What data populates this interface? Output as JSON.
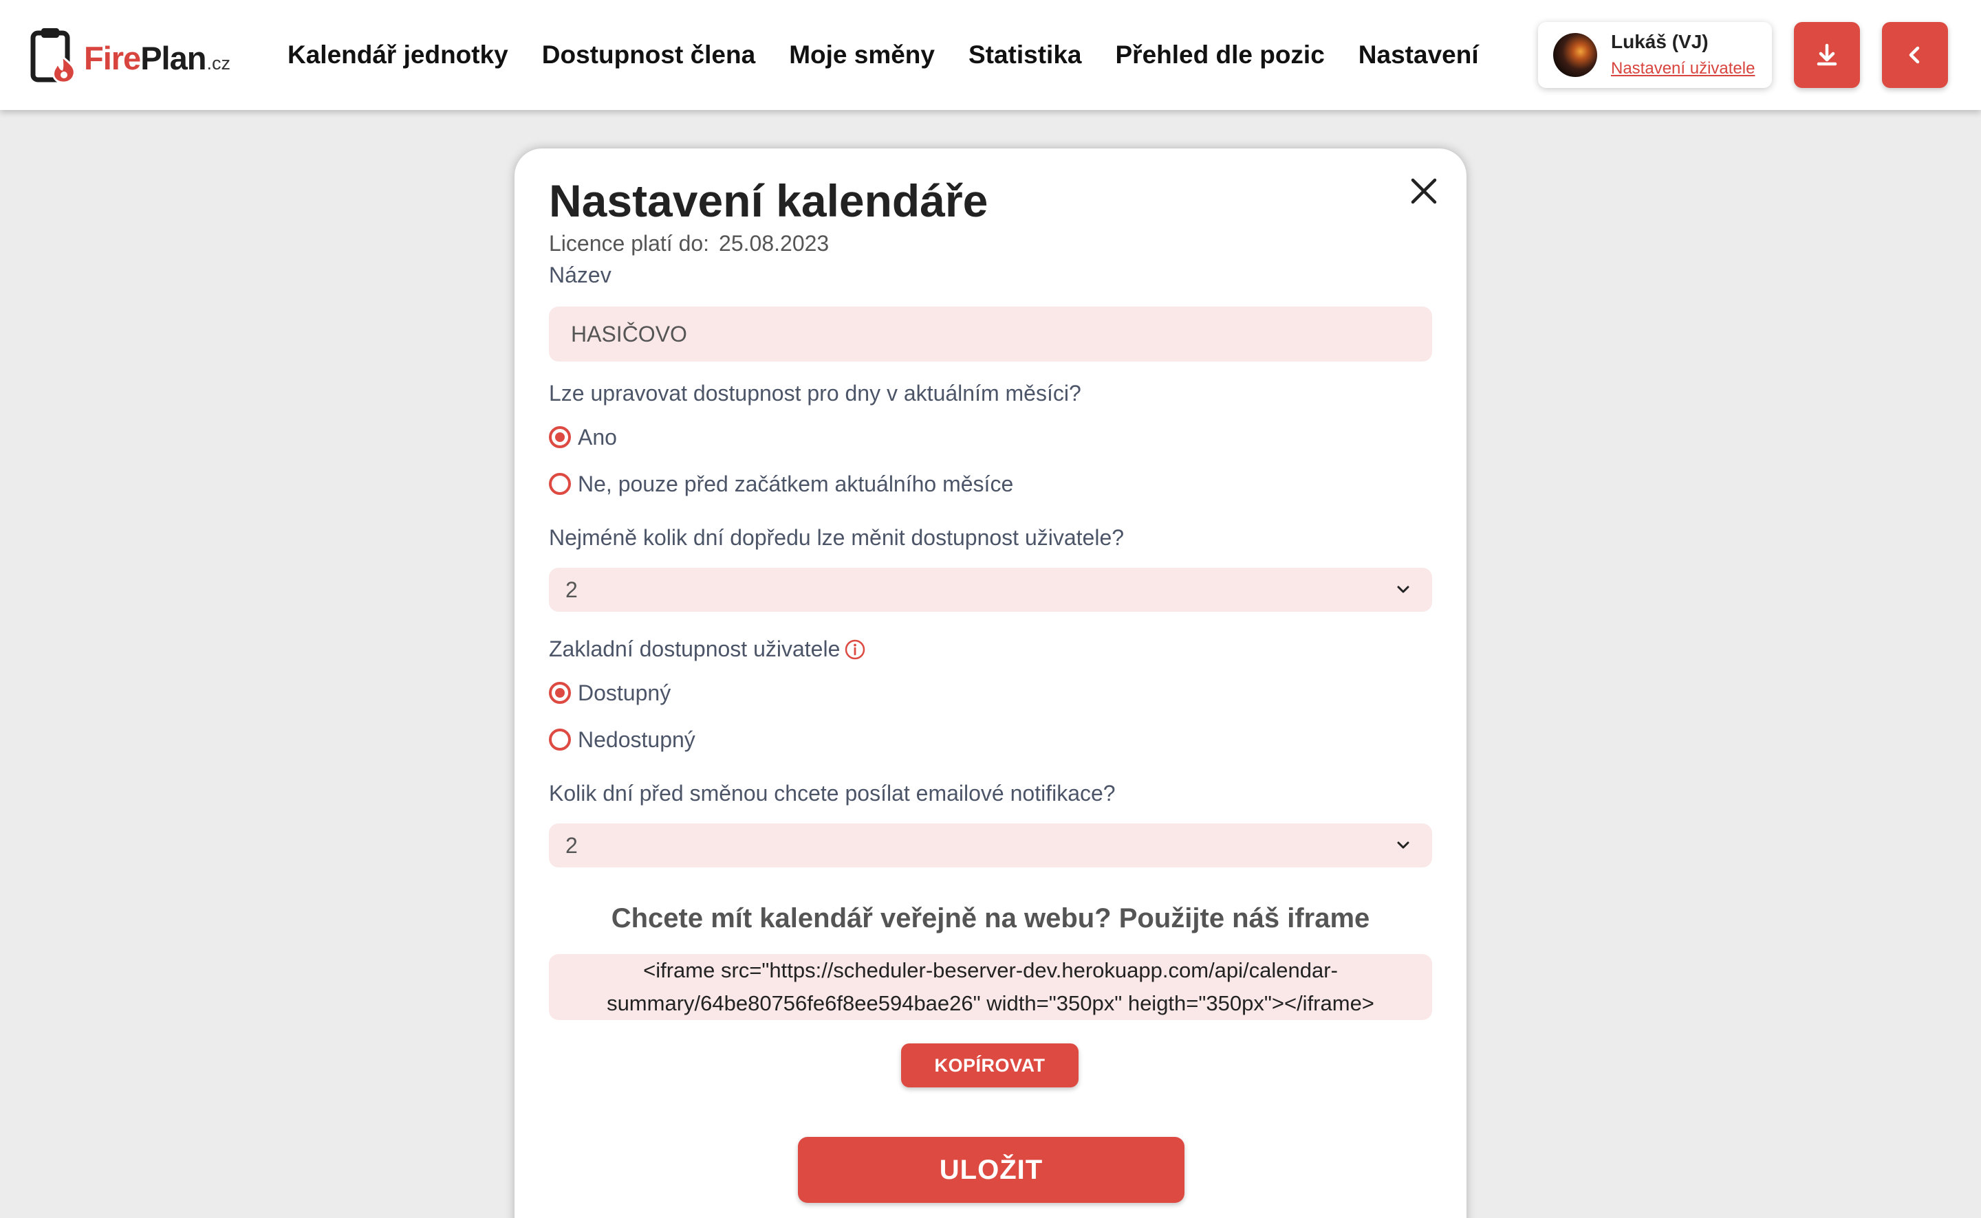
{
  "brand": {
    "fire": "Fire",
    "plan": "Plan",
    "tld": ".cz",
    "accent": "#dd4a42"
  },
  "nav": [
    {
      "label": "Kalendář jednotky"
    },
    {
      "label": "Dostupnost člena"
    },
    {
      "label": "Moje směny"
    },
    {
      "label": "Statistika"
    },
    {
      "label": "Přehled dle pozic"
    },
    {
      "label": "Nastavení"
    }
  ],
  "user": {
    "name": "Lukáš (VJ)",
    "settings_link": "Nastavení uživatele"
  },
  "header_buttons": {
    "download_icon": "download-icon",
    "back_icon": "chevron-left-icon"
  },
  "modal": {
    "title": "Nastavení kalendáře",
    "license_label": "Licence platí do:",
    "license_date": "25.08.2023",
    "name_label": "Název",
    "name_value": "HASIČOVO",
    "edit_current_month_question": "Lze upravovat dostupnost pro dny v aktuálním měsíci?",
    "edit_current_month_options": [
      {
        "label": "Ano",
        "selected": true
      },
      {
        "label": "Ne, pouze před začátkem aktuálního měsíce",
        "selected": false
      }
    ],
    "min_days_question": "Nejméně kolik dní dopředu lze měnit dostupnost uživatele?",
    "min_days_value": "2",
    "default_availability_label": "Zakladní dostupnost uživatele",
    "default_availability_options": [
      {
        "label": "Dostupný",
        "selected": true
      },
      {
        "label": "Nedostupný",
        "selected": false
      }
    ],
    "notify_days_question": "Kolik dní před směnou chcete posílat emailové notifikace?",
    "notify_days_value": "2",
    "iframe_heading": "Chcete mít kalendář veřejně na webu? Použijte náš iframe",
    "iframe_code_line1": "<iframe src=\"https://scheduler-beserver-dev.herokuapp.com/api/calendar-",
    "iframe_code_line2": "summary/64be80756fe6f8ee594bae26\" width=\"350px\" heigth=\"350px\"></iframe>",
    "copy_button": "KOPÍROVAT",
    "save_button": "ULOŽIT"
  }
}
